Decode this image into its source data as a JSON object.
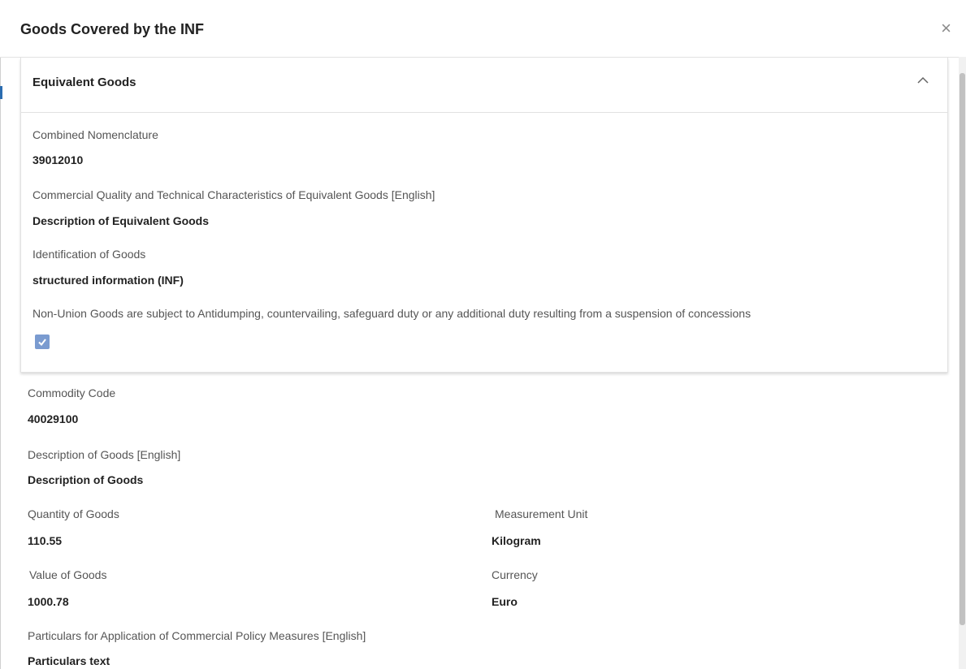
{
  "modal": {
    "title": "Goods Covered by the INF",
    "close_icon": "×"
  },
  "panel": {
    "title": "Equivalent Goods",
    "fields": {
      "combined_nomenclature": {
        "label": "Combined Nomenclature",
        "value": "39012010"
      },
      "commercial_quality": {
        "label": "Commercial Quality and Technical Characteristics of Equivalent Goods [English]",
        "value": "Description of Equivalent Goods"
      },
      "identification": {
        "label": "Identification of Goods",
        "value": "structured information (INF)"
      },
      "non_union": {
        "label": "Non-Union Goods are subject to Antidumping, countervailing, safeguard duty or any additional duty resulting from a suspension of concessions",
        "checked": true
      }
    }
  },
  "goods": {
    "commodity_code": {
      "label": "Commodity Code",
      "value": "40029100"
    },
    "description": {
      "label": "Description of Goods [English]",
      "value": "Description of Goods"
    },
    "quantity": {
      "label": "Quantity of Goods",
      "value": "110.55"
    },
    "measurement_unit": {
      "label": "Measurement Unit",
      "value": "Kilogram"
    },
    "value": {
      "label": "Value of Goods",
      "value": "1000.78"
    },
    "currency": {
      "label": "Currency",
      "value": "Euro"
    },
    "particulars": {
      "label": "Particulars for Application of Commercial Policy Measures [English]",
      "value": "Particulars text"
    }
  },
  "colors": {
    "checkbox": "#7a9bd0",
    "accent": "#2b6cb0"
  }
}
